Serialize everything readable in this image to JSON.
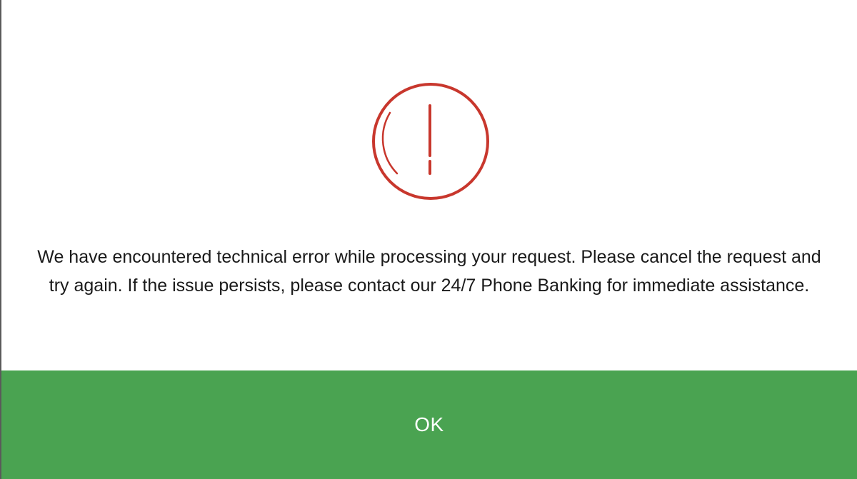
{
  "dialog": {
    "icon": "alert-exclamation-icon",
    "message": "We have encountered technical error while processing your request. Please cancel the request and try again. If the issue persists, please contact our 24/7 Phone Banking for immediate assistance.",
    "ok_label": "OK"
  },
  "colors": {
    "icon": "#c8372d",
    "button_background": "#4aa351",
    "button_text": "#ffffff",
    "message_text": "#1a1a1a",
    "background": "#ffffff"
  }
}
